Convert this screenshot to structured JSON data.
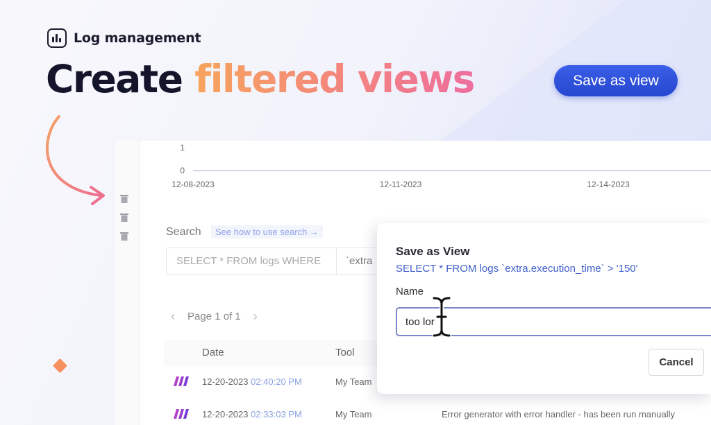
{
  "brand": {
    "label": "Log management",
    "icon": "bar-chart-icon"
  },
  "headline": {
    "plain": "Create",
    "highlight": "filtered views"
  },
  "hero_button": {
    "label": "Save as view"
  },
  "colors": {
    "accent_blue": "#2a4bd6",
    "gradient_start": "#f7a45c",
    "gradient_end": "#ee6e9e",
    "diamond": "#f79060"
  },
  "chart": {
    "y_ticks": [
      "1",
      "0"
    ],
    "x_ticks": [
      "12-08-2023",
      "12-11-2023",
      "12-14-2023"
    ]
  },
  "search": {
    "label": "Search",
    "help_link": "See how to use search →",
    "query_placeholder": "SELECT * FROM logs WHERE",
    "query_value": "`extra"
  },
  "pagination": {
    "prev": "‹",
    "label": "Page 1 of 1",
    "next": "›"
  },
  "table": {
    "columns": [
      "Date",
      "Tool"
    ],
    "rows": [
      {
        "date": "12-20-2023",
        "time": "02:40:20 PM",
        "team": "My Team",
        "description": ""
      },
      {
        "date": "12-20-2023",
        "time": "02:33:03 PM",
        "team": "My Team",
        "description": "Error generator with error handler - has been run manually"
      }
    ]
  },
  "modal": {
    "title": "Save as View",
    "query": "SELECT * FROM logs `extra.execution_time` > '150'",
    "name_label": "Name",
    "name_value": "too lor",
    "cancel_label": "Cancel"
  }
}
